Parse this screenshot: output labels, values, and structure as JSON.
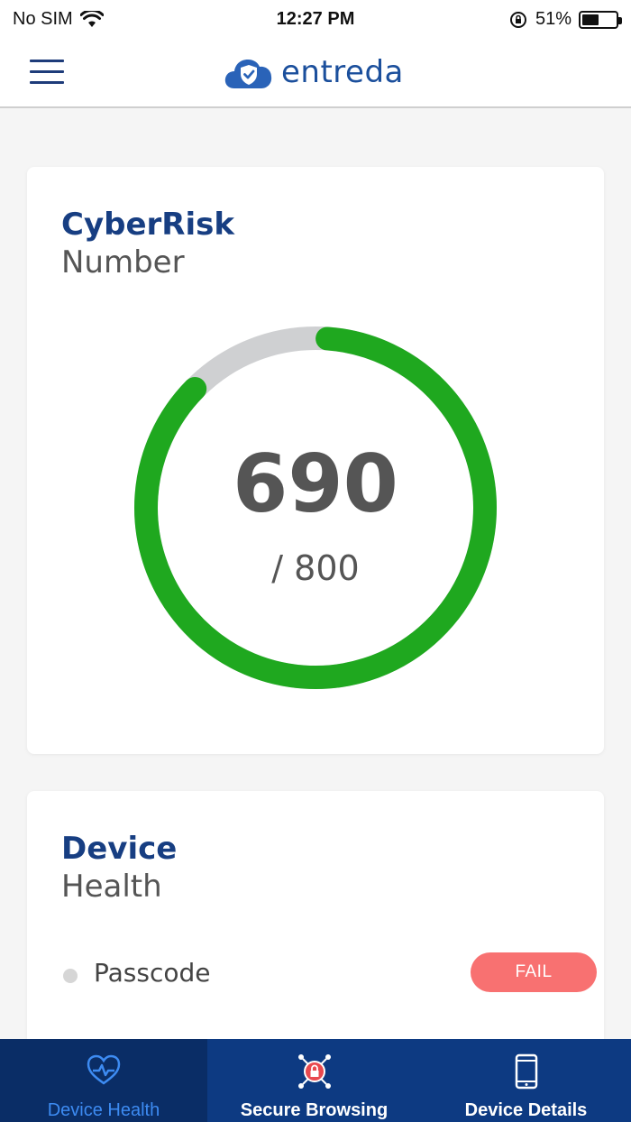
{
  "status_bar": {
    "carrier": "No SIM",
    "time": "12:27 PM",
    "battery": "51%",
    "battery_level": 0.51
  },
  "header": {
    "brand": "entreda",
    "icons": [
      "menu-icon",
      "cloud-shield-icon"
    ]
  },
  "cyberrisk": {
    "title": "CyberRisk",
    "subtitle": "Number",
    "score": "690",
    "max_label": "/ 800",
    "score_value": 690,
    "max_value": 800,
    "colors": {
      "progress": "#1fa81f",
      "track": "#cfd0d2"
    }
  },
  "device_health": {
    "title": "Device",
    "subtitle": "Health",
    "checks": [
      {
        "label": "Passcode",
        "status": "FAIL",
        "status_color": "#f87171"
      }
    ]
  },
  "tabs": [
    {
      "label": "Device Health",
      "icon": "heart-pulse-icon",
      "active": true
    },
    {
      "label": "Secure Browsing",
      "icon": "shield-lock-icon",
      "active": false
    },
    {
      "label": "Device Details",
      "icon": "phone-icon",
      "active": false
    }
  ],
  "colors": {
    "accent": "#173e82",
    "tabbar": "#0d3a82",
    "tab_active": "#0a2d66",
    "tab_active_text": "#3d8bf2"
  }
}
